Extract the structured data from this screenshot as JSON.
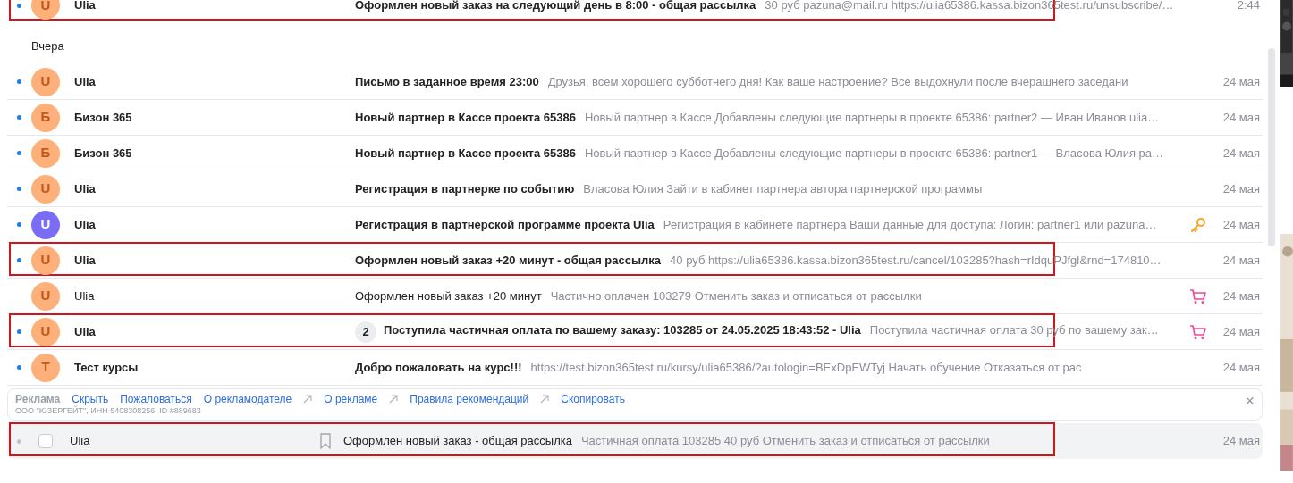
{
  "groups": [
    {
      "rows": [
        {
          "sender": "Ulia",
          "letter": "U",
          "color": "#fdb07a",
          "subject": "Оформлен новый заказ на следующий день в 8:00 - общая рассылка",
          "snippet": "30 руб pazuna@mail.ru https://ulia65386.kassa.bizon365test.ru/unsubscribe/…",
          "date": "2:44",
          "unread": true,
          "highlighted": true
        }
      ]
    },
    {
      "label": "Вчера",
      "rows": [
        {
          "sender": "Ulia",
          "letter": "U",
          "color": "#fdb07a",
          "subject": "Письмо в заданное время 23:00",
          "snippet": "Друзья, всем хорошего субботнего дня! Как ваше настроение? Все выдохнули после вчерашнего заседани",
          "date": "24 мая",
          "unread": true,
          "highlighted": false
        },
        {
          "sender": "Бизон 365",
          "letter": "Б",
          "color": "#fdb07a",
          "subject": "Новый партнер в Кассе проекта 65386",
          "snippet": "Новый партнер в Кассе Добавлены следующие партнеры в проекте 65386: partner2 — Иван Иванов ulia…",
          "date": "24 мая",
          "unread": true,
          "highlighted": false
        },
        {
          "sender": "Бизон 365",
          "letter": "Б",
          "color": "#fdb07a",
          "subject": "Новый партнер в Кассе проекта 65386",
          "snippet": "Новый партнер в Кассе Добавлены следующие партнеры в проекте 65386: partner1 — Власова Юлия ра…",
          "date": "24 мая",
          "unread": true,
          "highlighted": false
        },
        {
          "sender": "Ulia",
          "letter": "U",
          "color": "#fdb07a",
          "subject": "Регистрация в партнерке по событию",
          "snippet": "Власова Юлия Зайти в кабинет партнера автора партнерской программы",
          "date": "24 мая",
          "unread": true,
          "highlighted": false
        },
        {
          "sender": "Ulia",
          "letter": "U",
          "color": "#7a6cf5",
          "subject": "Регистрация в партнерской программе проекта Ulia",
          "snippet": "Регистрация в кабинете партнера Ваши данные для доступа: Логин: partner1 или pazuna…",
          "date": "24 мая",
          "unread": true,
          "highlighted": false,
          "kind": "key"
        },
        {
          "sender": "Ulia",
          "letter": "U",
          "color": "#fdb07a",
          "subject": "Оформлен новый заказ +20 минут - общая рассылка",
          "snippet": "40 руб https://ulia65386.kassa.bizon365test.ru/cancel/103285?hash=rIdquPJfgl&rnd=174810…",
          "date": "24 мая",
          "unread": true,
          "highlighted": true
        },
        {
          "sender": "Ulia",
          "letter": "U",
          "color": "#fdb07a",
          "subject": "Оформлен новый заказ +20 минут",
          "snippet": "Частично оплачен 103279 Отменить заказ и отписаться от рассылки",
          "date": "24 мая",
          "unread": false,
          "highlighted": false,
          "kind": "cart"
        },
        {
          "sender": "Ulia",
          "letter": "U",
          "color": "#fdb07a",
          "count": "2",
          "subject": "Поступила частичная оплата по вашему заказу: 103285 от 24.05.2025 18:43:52 - Ulia",
          "snippet": "Поступила частичная оплата 30 руб по вашему зак…",
          "date": "24 мая",
          "unread": true,
          "highlighted": true,
          "kind": "cart"
        },
        {
          "sender": "Тест курсы",
          "letter": "Т",
          "color": "#fdb07a",
          "subject": "Добро пожаловать на курс!!!",
          "snippet": "https://test.bizon365test.ru/kursy/ulia65386/?autologin=BExDpEWTyj Начать обучение Отказаться от рас",
          "date": "24 мая",
          "unread": true,
          "highlighted": false
        }
      ]
    }
  ],
  "ad_bar": {
    "label": "Реклама",
    "links": [
      {
        "text": "Скрыть",
        "external": false
      },
      {
        "text": "Пожаловаться",
        "external": false
      },
      {
        "text": "О рекламодателе",
        "external": true
      },
      {
        "text": "О рекламе",
        "external": true
      },
      {
        "text": "Правила рекомендаций",
        "external": true
      },
      {
        "text": "Скопировать",
        "external": false
      }
    ],
    "advertiser": "ООО \"ЮЗЕРГЕЙТ\", ИНН 5408308256, ID #889683",
    "close": "×"
  },
  "hovered_row": {
    "sender": "Ulia",
    "subject": "Оформлен новый заказ - общая рассылка",
    "snippet": "Частичная оплата 103285 40 руб Отменить заказ и отписаться от рассылки",
    "date": "24 мая",
    "checked": false,
    "highlighted": true
  }
}
